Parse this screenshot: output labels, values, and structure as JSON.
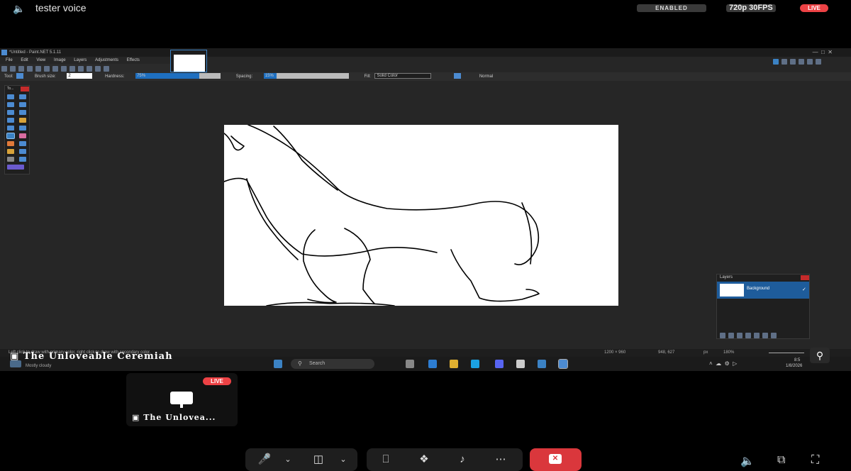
{
  "top": {
    "voice_icon": "speaker-icon",
    "channel_name": "tester voice",
    "enabled_badge": "ENABLED",
    "quality": "720p 30FPS",
    "live": "LIVE"
  },
  "paint": {
    "title": "*Untitled - Paint.NET 5.1.11",
    "menu": [
      "File",
      "Edit",
      "View",
      "Image",
      "Layers",
      "Adjustments",
      "Effects"
    ],
    "tool_label": "Tool:",
    "brush_size_label": "Brush size:",
    "brush_size_value": "2",
    "hardness_label": "Hardness:",
    "hardness_value": "75%",
    "spacing_label": "Spacing:",
    "spacing_value": "15%",
    "fill_label": "Fill:",
    "fill_value": "Solid Color",
    "blend_value": "Normal",
    "tools_title": "To...",
    "layers_title": "Layers",
    "layer_name": "Background",
    "status_hint": "Left click to draw with primary color, right click to draw with secondary color.",
    "image_size": "1200 × 960",
    "cursor_pos": "948, 627",
    "units": "px",
    "zoom": "180%"
  },
  "taskbar": {
    "search_placeholder": "Search",
    "weather": "Mostly cloudy",
    "time": "8:5",
    "date": "1/8/2026"
  },
  "overlay": {
    "streamer_name": "The Unloveable Ceremiah"
  },
  "tile": {
    "live": "LIVE",
    "name": "The Unlovea..."
  },
  "controls": {
    "mic_icon": "microphone-icon",
    "camera_icon": "camera-off-icon",
    "screen_share_icon": "screen-share-icon",
    "activities_icon": "activities-icon",
    "soundboard_icon": "soundboard-icon",
    "more_icon": "more-icon",
    "leave_icon": "leave-call-icon",
    "volume_icon": "volume-icon",
    "popout_icon": "popout-icon",
    "fullscreen_icon": "fullscreen-icon"
  },
  "colors": {
    "live_red": "#ed4245",
    "leave_red": "#da373c",
    "accent_blue": "#3b82c4"
  }
}
